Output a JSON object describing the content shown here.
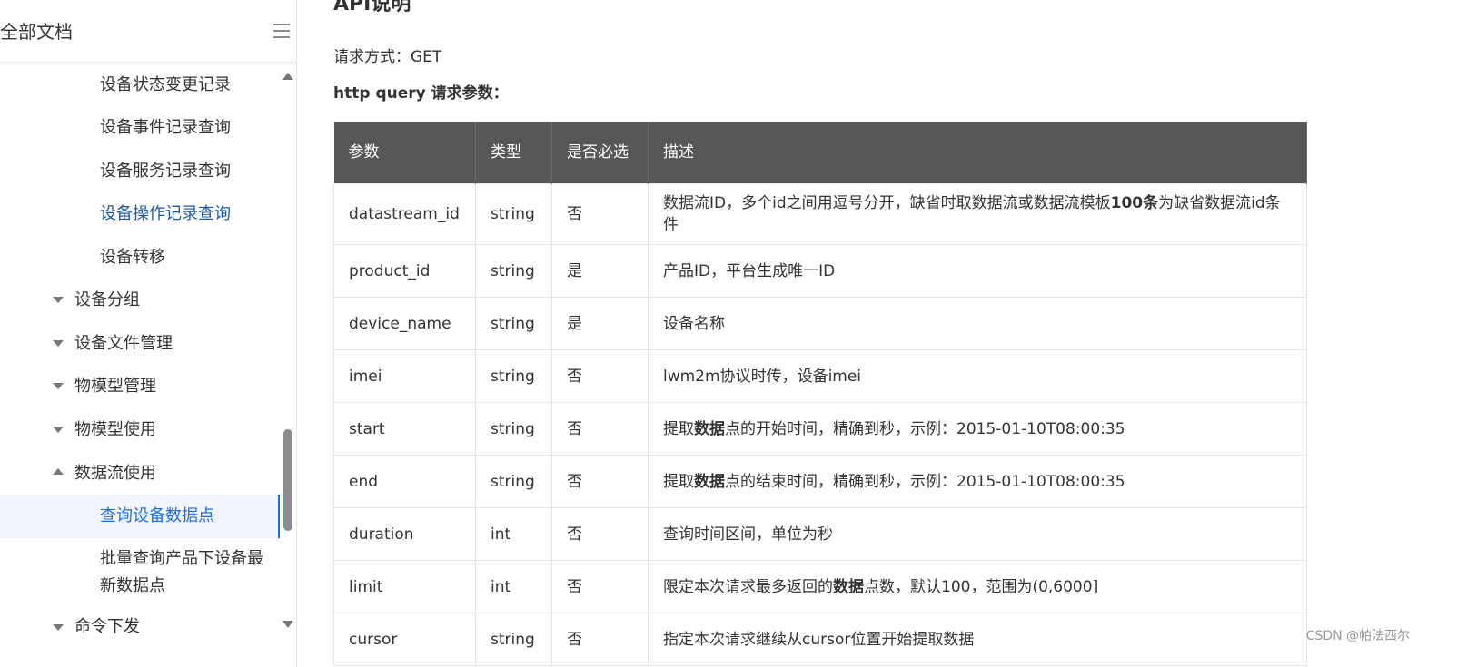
{
  "sidebar": {
    "title": "全部文档",
    "items": [
      {
        "label": "设备状态变更记录"
      },
      {
        "label": "设备事件记录查询"
      },
      {
        "label": "设备服务记录查询"
      },
      {
        "label": "设备操作记录查询"
      },
      {
        "label": "设备转移"
      },
      {
        "label": "设备分组"
      },
      {
        "label": "设备文件管理"
      },
      {
        "label": "物模型管理"
      },
      {
        "label": "物模型使用"
      },
      {
        "label": "数据流使用"
      },
      {
        "label": "查询设备数据点"
      },
      {
        "label_line1": "批量查询产品下设备最",
        "label_line2": "新数据点"
      },
      {
        "label": "命令下发"
      }
    ]
  },
  "main": {
    "section_title": "API说明",
    "request_method": "请求方式：GET",
    "params_title": "http query 请求参数：",
    "table": {
      "headers": [
        "参数",
        "类型",
        "是否必选",
        "描述"
      ],
      "rows": [
        {
          "param": "datastream_id",
          "type": "string",
          "required": "否",
          "desc_a": "数据流ID，多个id之间用逗号分开，缺省时取数据流或数据流模板",
          "desc_b": "100条",
          "desc_c": "为缺省数据流id条件"
        },
        {
          "param": "product_id",
          "type": "string",
          "required": "是",
          "desc_a": "产品ID，平台生成唯一ID"
        },
        {
          "param": "device_name",
          "type": "string",
          "required": "是",
          "desc_a": "设备名称"
        },
        {
          "param": "imei",
          "type": "string",
          "required": "否",
          "desc_a": "lwm2m协议时传，设备imei"
        },
        {
          "param": "start",
          "type": "string",
          "required": "否",
          "desc_a": "提取",
          "desc_b": "数据",
          "desc_c": "点的开始时间，精确到秒，示例：2015-01-10T08:00:35"
        },
        {
          "param": "end",
          "type": "string",
          "required": "否",
          "desc_a": "提取",
          "desc_b": "数据",
          "desc_c": "点的结束时间，精确到秒，示例：2015-01-10T08:00:35"
        },
        {
          "param": "duration",
          "type": "int",
          "required": "否",
          "desc_a": "查询时间区间，单位为秒"
        },
        {
          "param": "limit",
          "type": "int",
          "required": "否",
          "desc_a": "限定本次请求最多返回的",
          "desc_b": "数据",
          "desc_c": "点数，默认100，范围为(0,6000]"
        },
        {
          "param": "cursor",
          "type": "string",
          "required": "否",
          "desc_a": "指定本次请求继续从cursor位置开始提取数据"
        }
      ]
    }
  },
  "watermark": "CSDN @帕法西尔",
  "colors": {
    "header_bg": "#575757",
    "active_link": "#1e6fd9",
    "current_link": "#1e5aa8"
  }
}
